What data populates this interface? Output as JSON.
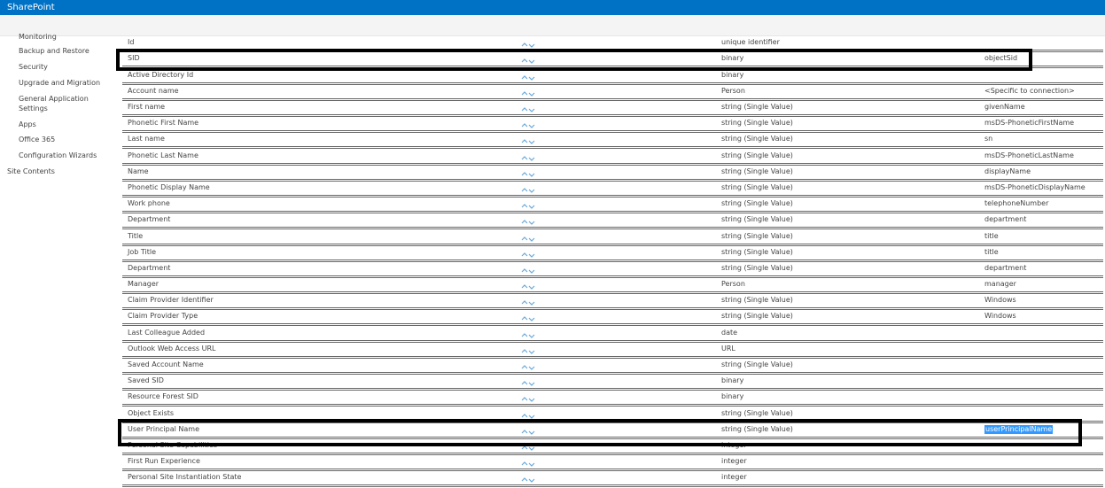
{
  "app": {
    "title": "SharePoint"
  },
  "colors": {
    "brand": "#0072c6",
    "selection": "#3399ff",
    "arrow": "#6aa8d8"
  },
  "nav": {
    "items": [
      {
        "label": "Monitoring"
      },
      {
        "label": "Backup and Restore"
      },
      {
        "label": "Security"
      },
      {
        "label": "Upgrade and Migration"
      },
      {
        "label": "General Application Settings"
      },
      {
        "label": "Apps"
      },
      {
        "label": "Office 365"
      },
      {
        "label": "Configuration Wizards"
      },
      {
        "label": "Site Contents"
      }
    ]
  },
  "table": {
    "icons": {
      "up": "chevron-up-icon",
      "down": "chevron-down-icon"
    },
    "rows": [
      {
        "name": "Id",
        "type": "unique identifier",
        "mapping": ""
      },
      {
        "name": "SID",
        "type": "binary",
        "mapping": "objectSid"
      },
      {
        "name": "Active Directory Id",
        "type": "binary",
        "mapping": ""
      },
      {
        "name": "Account name",
        "type": "Person",
        "mapping": "<Specific to connection>"
      },
      {
        "name": "First name",
        "type": "string (Single Value)",
        "mapping": "givenName"
      },
      {
        "name": "Phonetic First Name",
        "type": "string (Single Value)",
        "mapping": "msDS-PhoneticFirstName"
      },
      {
        "name": "Last name",
        "type": "string (Single Value)",
        "mapping": "sn"
      },
      {
        "name": "Phonetic Last Name",
        "type": "string (Single Value)",
        "mapping": "msDS-PhoneticLastName"
      },
      {
        "name": "Name",
        "type": "string (Single Value)",
        "mapping": "displayName"
      },
      {
        "name": "Phonetic Display Name",
        "type": "string (Single Value)",
        "mapping": "msDS-PhoneticDisplayName"
      },
      {
        "name": "Work phone",
        "type": "string (Single Value)",
        "mapping": "telephoneNumber"
      },
      {
        "name": "Department",
        "type": "string (Single Value)",
        "mapping": "department"
      },
      {
        "name": "Title",
        "type": "string (Single Value)",
        "mapping": "title"
      },
      {
        "name": "Job Title",
        "type": "string (Single Value)",
        "mapping": "title"
      },
      {
        "name": "Department",
        "type": "string (Single Value)",
        "mapping": "department"
      },
      {
        "name": "Manager",
        "type": "Person",
        "mapping": "manager"
      },
      {
        "name": "Claim Provider Identifier",
        "type": "string (Single Value)",
        "mapping": "Windows"
      },
      {
        "name": "Claim Provider Type",
        "type": "string (Single Value)",
        "mapping": "Windows"
      },
      {
        "name": "Last Colleague Added",
        "type": "date",
        "mapping": ""
      },
      {
        "name": "Outlook Web Access URL",
        "type": "URL",
        "mapping": ""
      },
      {
        "name": "Saved Account Name",
        "type": "string (Single Value)",
        "mapping": ""
      },
      {
        "name": "Saved SID",
        "type": "binary",
        "mapping": ""
      },
      {
        "name": "Resource Forest SID",
        "type": "binary",
        "mapping": ""
      },
      {
        "name": "Object Exists",
        "type": "string (Single Value)",
        "mapping": ""
      },
      {
        "name": "User Principal Name",
        "type": "string (Single Value)",
        "mapping": "userPrincipalName",
        "selected": true
      },
      {
        "name": "Personal Site Capabilities",
        "type": "integer",
        "mapping": ""
      },
      {
        "name": "First Run Experience",
        "type": "integer",
        "mapping": ""
      },
      {
        "name": "Personal Site Instantiation State",
        "type": "integer",
        "mapping": ""
      }
    ]
  }
}
